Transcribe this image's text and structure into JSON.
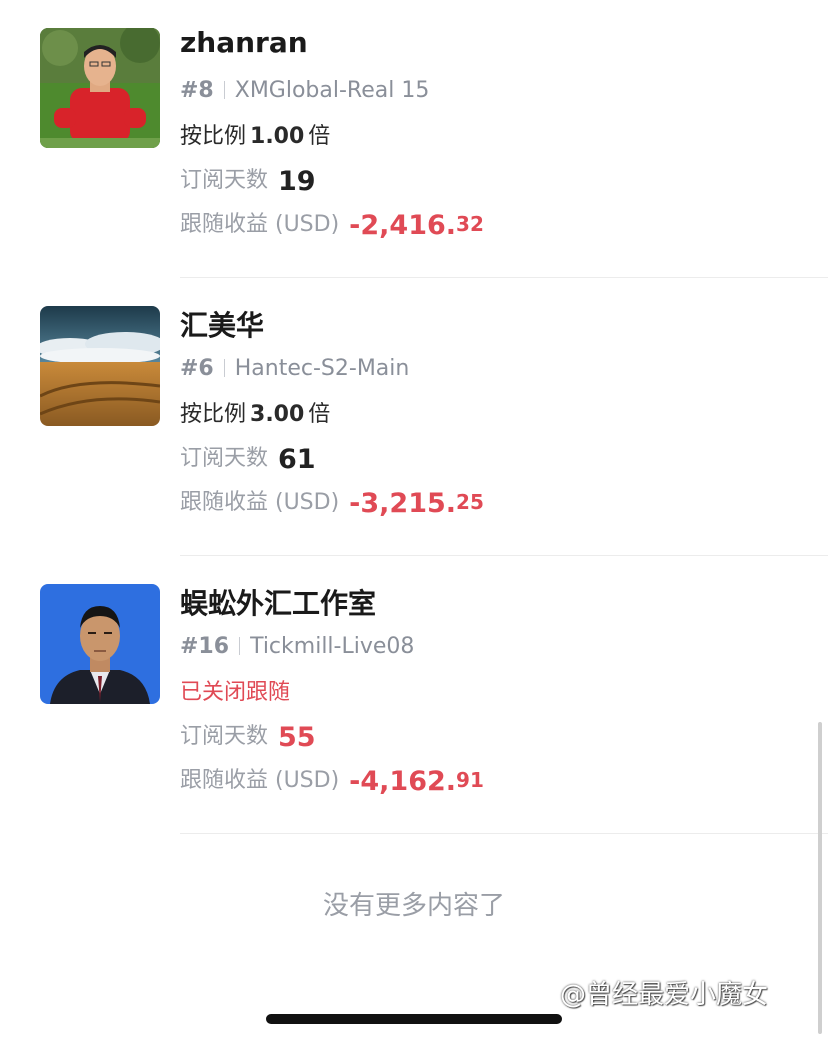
{
  "labels": {
    "ratio_prefix": "按比例",
    "ratio_suffix": "倍",
    "days": "订阅天数",
    "profit": "跟随收益 (USD)"
  },
  "traders": [
    {
      "name": "zhanran",
      "rank": "#8",
      "account": "XMGlobal-Real 15",
      "ratio": "1.00",
      "days": "19",
      "profit_int": "-2,416.",
      "profit_dec": "32",
      "avatar": "man-in-red-shirt-photo"
    },
    {
      "name": "汇美华",
      "rank": "#6",
      "account": "Hantec-S2-Main",
      "ratio": "3.00",
      "days": "61",
      "profit_int": "-3,215.",
      "profit_dec": "25",
      "avatar": "wheat-field-landscape-photo"
    },
    {
      "name": "蜈蚣外汇工作室",
      "rank": "#16",
      "account": "Tickmill-Live08",
      "status": "已关闭跟随",
      "days": "55",
      "profit_int": "-4,162.",
      "profit_dec": "91",
      "avatar": "man-portrait-blue-background-photo"
    }
  ],
  "footer": {
    "end_text": "没有更多内容了",
    "watermark": "@曾经最爱小魔女"
  },
  "colors": {
    "negative": "#e04a55",
    "muted": "#9a9ea6"
  }
}
